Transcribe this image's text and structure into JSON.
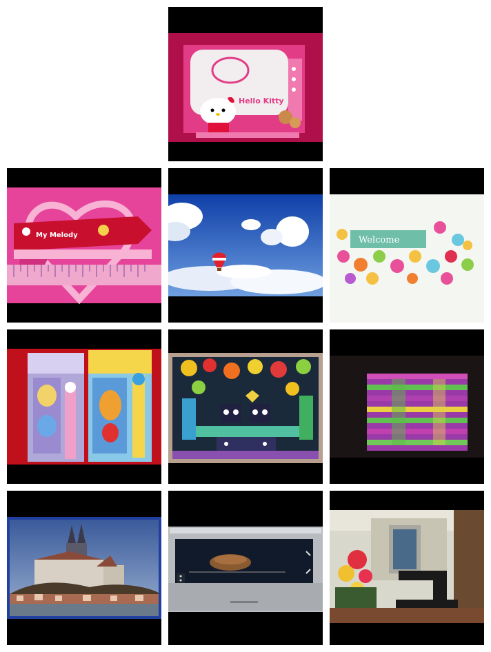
{
  "grid": {
    "rows": 4,
    "columns": 3,
    "tiles": [
      {
        "id": "hello-kitty-toaster-box",
        "label": "Hello Kitty"
      },
      {
        "id": "my-melody-ruler",
        "label": "My Melody"
      },
      {
        "id": "hot-air-balloon-sky",
        "label": ""
      },
      {
        "id": "welcome-flower-sign",
        "label": "Welcome"
      },
      {
        "id": "princess-stationery-packs",
        "label": ""
      },
      {
        "id": "colorful-cat-painting",
        "label": ""
      },
      {
        "id": "knitted-dishcloth",
        "label": ""
      },
      {
        "id": "castle-on-hill",
        "label": ""
      },
      {
        "id": "oven-with-roast",
        "label": ""
      },
      {
        "id": "sewing-machine-flowers",
        "label": ""
      }
    ]
  },
  "colors": {
    "background": "#ffffff",
    "letterbox": "#000000"
  }
}
